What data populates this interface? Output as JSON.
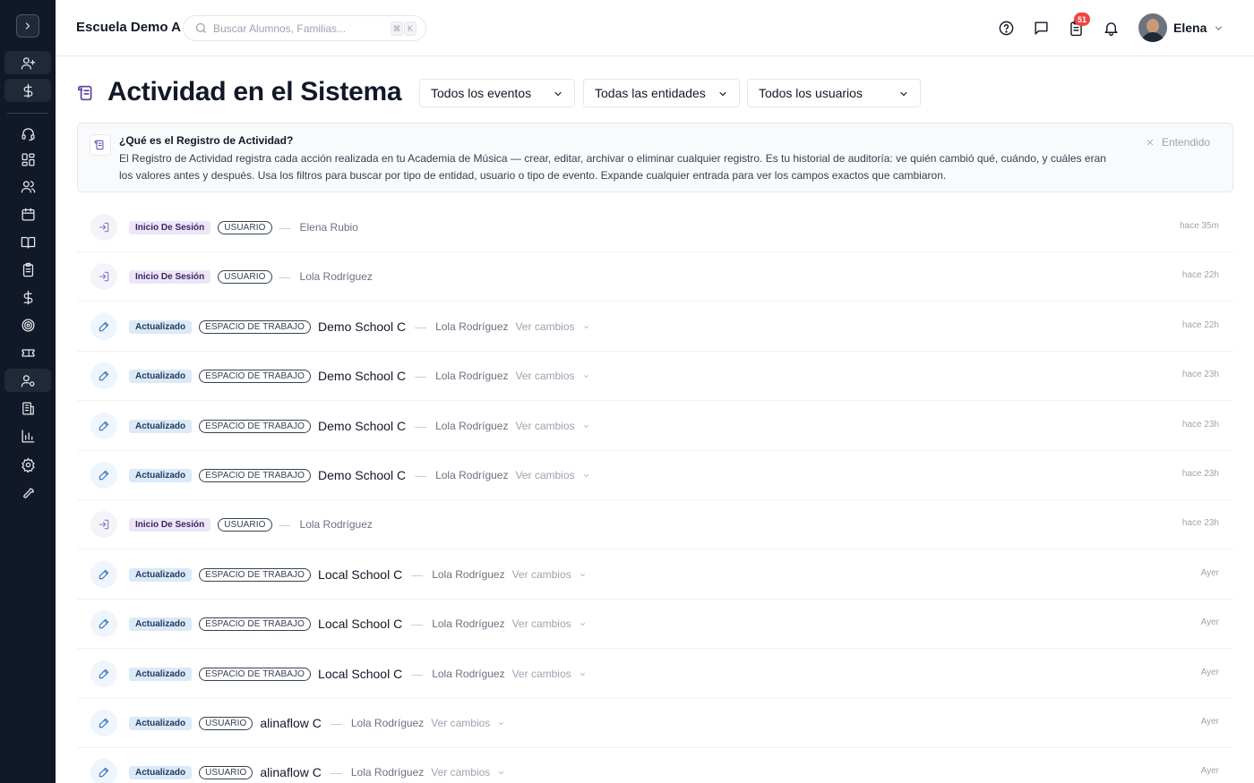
{
  "topbar": {
    "school_name": "Escuela Demo A",
    "search_placeholder": "Buscar Alumnos, Familias...",
    "shortcut_keys": [
      "⌘",
      "K"
    ],
    "tasks_badge": "51",
    "user_name": "Elena"
  },
  "header": {
    "title": "Actividad en el Sistema",
    "filters": [
      "Todos los eventos",
      "Todas las entidades",
      "Todos los usuarios"
    ]
  },
  "info": {
    "title": "¿Qué es el Registro de Actividad?",
    "text": "El Registro de Actividad registra cada acción realizada en tu Academia de Música — crear, editar, archivar o eliminar cualquier registro. Es tu historial de auditoría: ve quién cambió qué, cuándo, y cuáles eran los valores antes y después. Usa los filtros para buscar por tipo de entidad, usuario o tipo de evento. Expande cualquier entrada para ver los campos exactos que cambiaron.",
    "dismiss": "Entendido"
  },
  "colors": {
    "sidebar_bg": "#111827",
    "login_badge": "#ede6f8",
    "updated_badge": "#dce9f7",
    "accent_purple": "#5b3f9c",
    "notification_red": "#ef4444"
  },
  "sidebar_icons": [
    "chevron-right-icon",
    "user-plus-icon",
    "dollar-icon",
    "headset-icon",
    "dashboard-icon",
    "users-icon",
    "calendar-icon",
    "book-icon",
    "clipboard-icon",
    "dollar-icon",
    "target-icon",
    "ticket-icon",
    "user-cog-icon",
    "building-icon",
    "bar-chart-icon",
    "gear-icon",
    "wrench-icon"
  ],
  "activity": [
    {
      "type": "login",
      "event": "Inicio De Sesión",
      "entity_type": "USUARIO",
      "entity": "",
      "actor": "Elena Rubio",
      "changes": "",
      "time": "hace 35m"
    },
    {
      "type": "login",
      "event": "Inicio De Sesión",
      "entity_type": "USUARIO",
      "entity": "",
      "actor": "Lola Rodríguez",
      "changes": "",
      "time": "hace 22h"
    },
    {
      "type": "edit",
      "event": "Actualizado",
      "entity_type": "ESPACIO DE TRABAJO",
      "entity": "Demo School C",
      "actor": "Lola Rodríguez",
      "changes": "Ver cambios",
      "time": "hace 22h"
    },
    {
      "type": "edit",
      "event": "Actualizado",
      "entity_type": "ESPACIO DE TRABAJO",
      "entity": "Demo School C",
      "actor": "Lola Rodríguez",
      "changes": "Ver cambios",
      "time": "hace 23h"
    },
    {
      "type": "edit",
      "event": "Actualizado",
      "entity_type": "ESPACIO DE TRABAJO",
      "entity": "Demo School C",
      "actor": "Lola Rodríguez",
      "changes": "Ver cambios",
      "time": "hace 23h"
    },
    {
      "type": "edit",
      "event": "Actualizado",
      "entity_type": "ESPACIO DE TRABAJO",
      "entity": "Demo School C",
      "actor": "Lola Rodríguez",
      "changes": "Ver cambios",
      "time": "hace 23h"
    },
    {
      "type": "login",
      "event": "Inicio De Sesión",
      "entity_type": "USUARIO",
      "entity": "",
      "actor": "Lola Rodríguez",
      "changes": "",
      "time": "hace 23h"
    },
    {
      "type": "edit",
      "event": "Actualizado",
      "entity_type": "ESPACIO DE TRABAJO",
      "entity": "Local School C",
      "actor": "Lola Rodríguez",
      "changes": "Ver cambios",
      "time": "Ayer"
    },
    {
      "type": "edit",
      "event": "Actualizado",
      "entity_type": "ESPACIO DE TRABAJO",
      "entity": "Local School C",
      "actor": "Lola Rodríguez",
      "changes": "Ver cambios",
      "time": "Ayer"
    },
    {
      "type": "edit",
      "event": "Actualizado",
      "entity_type": "ESPACIO DE TRABAJO",
      "entity": "Local School C",
      "actor": "Lola Rodríguez",
      "changes": "Ver cambios",
      "time": "Ayer"
    },
    {
      "type": "edit",
      "event": "Actualizado",
      "entity_type": "USUARIO",
      "entity": "alinaflow C",
      "actor": "Lola Rodríguez",
      "changes": "Ver cambios",
      "time": "Ayer"
    },
    {
      "type": "edit",
      "event": "Actualizado",
      "entity_type": "USUARIO",
      "entity": "alinaflow C",
      "actor": "Lola Rodríguez",
      "changes": "Ver cambios",
      "time": "Ayer"
    }
  ]
}
